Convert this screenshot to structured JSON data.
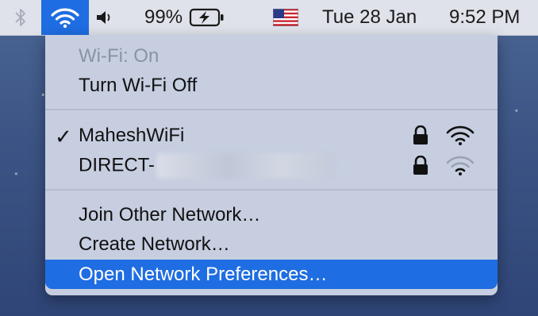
{
  "menubar": {
    "bluetooth_icon": "bluetooth-icon",
    "wifi_icon": "wifi-icon",
    "volume_icon": "volume-icon",
    "battery_percent": "99%",
    "battery_icon": "battery-charging-icon",
    "flag_icon": "us-flag-icon",
    "date": "Tue 28 Jan",
    "time": "9:52 PM",
    "accent_color": "#1f6de2"
  },
  "wifi_menu": {
    "status": "Wi-Fi: On",
    "toggle_label": "Turn Wi-Fi Off",
    "networks": [
      {
        "name": "MaheshWiFi",
        "connected": true,
        "secured": true
      },
      {
        "name": "DIRECT-",
        "connected": false,
        "secured": true
      }
    ],
    "actions": {
      "join_other": "Join Other Network…",
      "create": "Create Network…",
      "open_prefs": "Open Network Preferences…"
    },
    "check_mark": "✓"
  }
}
